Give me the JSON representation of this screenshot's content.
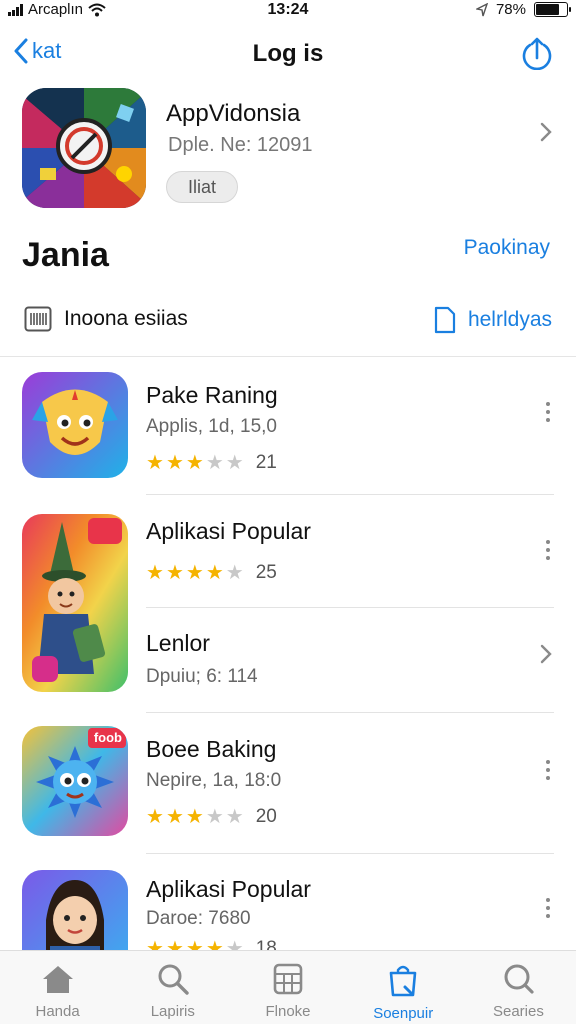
{
  "status_bar": {
    "carrier": "Arcaplın",
    "time": "13:24",
    "battery": "78%",
    "battery_level": 0.78
  },
  "nav": {
    "back_label": "kat",
    "title": "Log is"
  },
  "featured": {
    "title": "AppVidonsia",
    "subtitle": "Dple. Ne: 12091",
    "button": "Iliat"
  },
  "section": {
    "title": "Jania",
    "link": "Paokinay"
  },
  "filters": {
    "left_label": "Inoona esiias",
    "right_label": "helrldyas"
  },
  "apps": [
    {
      "name": "Pake Raning",
      "subtitle": "Applis, 1d, 15,0",
      "rating": 2.5,
      "rating_count": "21"
    },
    {
      "name": "Aplikasi Popular",
      "rating": 3.5,
      "rating_count": "25"
    },
    {
      "name": "Lenlor",
      "subtitle": "Dpuiu; 6: 114"
    },
    {
      "name": "Boee Baking",
      "subtitle": "Nepire, 1a, 18:0",
      "rating": 3,
      "rating_count": "20",
      "badge": "foob"
    },
    {
      "name": "Aplikasi Popular",
      "subtitle": "Daroe: 7680",
      "rating": 4,
      "rating_count": "18"
    }
  ],
  "tabs": [
    {
      "label": "Handa",
      "icon": "home-icon"
    },
    {
      "label": "Lapiris",
      "icon": "search-icon"
    },
    {
      "label": "Flnoke",
      "icon": "grid-icon"
    },
    {
      "label": "Soenpuir",
      "icon": "bag-icon",
      "active": true
    },
    {
      "label": "Searies",
      "icon": "search-icon"
    }
  ],
  "colors": {
    "accent": "#1a7fe0",
    "star": "#f5b300",
    "star_off": "#c8c8c8"
  }
}
